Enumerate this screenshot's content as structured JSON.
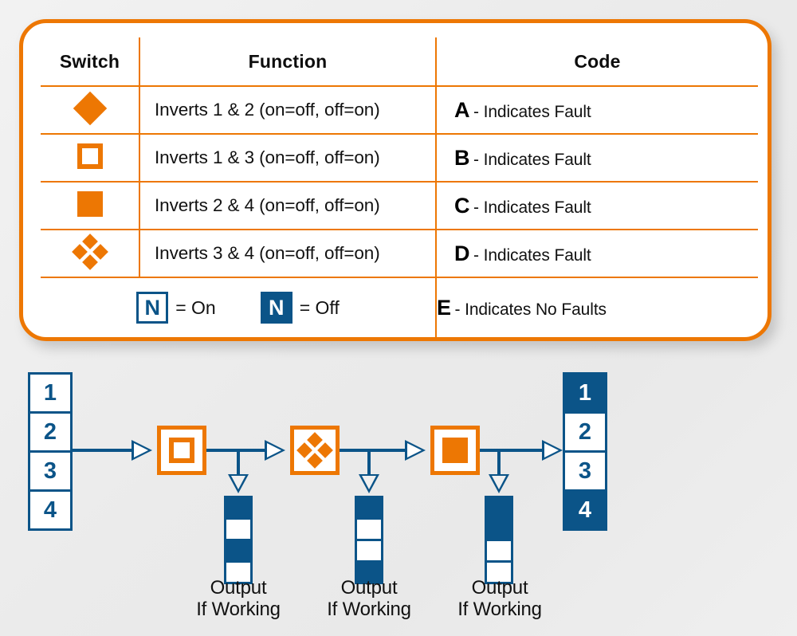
{
  "card": {
    "accent_orange": "#ED7703",
    "accent_blue": "#0B5488",
    "headers": {
      "switch": "Switch",
      "function": "Function",
      "code": "Code"
    },
    "rows": [
      {
        "symbol": "solid-diamond",
        "function": "Inverts 1 & 2 (on=off, off=on)",
        "code_letter": "A",
        "code_desc": "- Indicates Fault"
      },
      {
        "symbol": "hollow-square",
        "function": "Inverts 1 & 3 (on=off, off=on)",
        "code_letter": "B",
        "code_desc": "- Indicates Fault"
      },
      {
        "symbol": "solid-square",
        "function": "Inverts 2 & 4 (on=off, off=on)",
        "code_letter": "C",
        "code_desc": "- Indicates Fault"
      },
      {
        "symbol": "diamond-cluster",
        "function": "Inverts 3 & 4 (on=off, off=on)",
        "code_letter": "D",
        "code_desc": "- Indicates Fault"
      }
    ],
    "legend": {
      "on": {
        "glyph": "N",
        "label": "= On"
      },
      "off": {
        "glyph": "N",
        "label": "= Off"
      },
      "code_letter": "E",
      "code_desc": "- Indicates No Faults"
    }
  },
  "diagram": {
    "input_stack": {
      "name": "input-switch-stack",
      "cells": [
        {
          "label": "1",
          "state": "on"
        },
        {
          "label": "2",
          "state": "on"
        },
        {
          "label": "3",
          "state": "on"
        },
        {
          "label": "4",
          "state": "on"
        }
      ]
    },
    "output_stack": {
      "name": "output-switch-stack",
      "cells": [
        {
          "label": "1",
          "state": "off"
        },
        {
          "label": "2",
          "state": "on"
        },
        {
          "label": "3",
          "state": "on"
        },
        {
          "label": "4",
          "state": "off"
        }
      ]
    },
    "gates": [
      {
        "symbol": "hollow-square",
        "code": "B"
      },
      {
        "symbol": "diamond-cluster",
        "code": "D"
      },
      {
        "symbol": "solid-square",
        "code": "C"
      }
    ],
    "outputs": [
      {
        "label_line1": "Output",
        "label_line2": "If Working",
        "cells": [
          "off",
          "on",
          "off",
          "on"
        ]
      },
      {
        "label_line1": "Output",
        "label_line2": "If Working",
        "cells": [
          "off",
          "on",
          "on",
          "off"
        ]
      },
      {
        "label_line1": "Output",
        "label_line2": "If Working",
        "cells": [
          "off",
          "off",
          "on",
          "on"
        ]
      }
    ]
  }
}
